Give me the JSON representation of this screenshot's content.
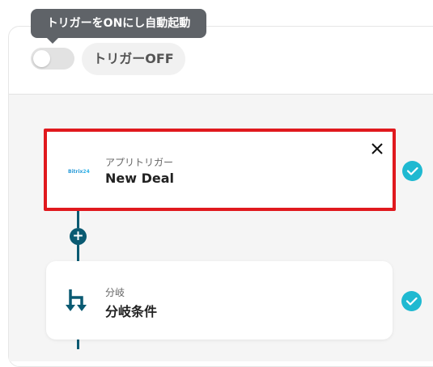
{
  "tooltip": {
    "text": "トリガーをONにし自動起動"
  },
  "trigger_toggle": {
    "status_label": "トリガーOFF",
    "on": false
  },
  "steps": [
    {
      "app_name": "Bitrix24",
      "logo_text": "Bitrix",
      "logo_num": "24",
      "category": "アプリトリガー",
      "title": "New Deal",
      "selected": true,
      "complete": true,
      "icon": "bitrix24-logo"
    },
    {
      "category": "分岐",
      "title": "分岐条件",
      "selected": false,
      "complete": true,
      "icon": "branch-icon"
    }
  ],
  "add_step": {
    "label": "+"
  },
  "colors": {
    "accent": "#0a5a72",
    "check": "#1fb9d1",
    "selection": "#e0191e",
    "tooltip_bg": "#5f6368"
  }
}
